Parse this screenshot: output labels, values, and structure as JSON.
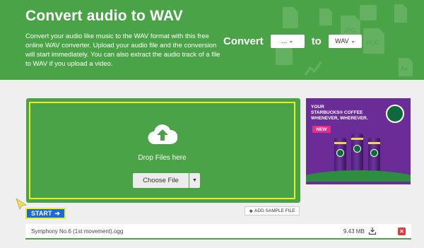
{
  "hero": {
    "title": "Convert audio to WAV",
    "description": "Convert your audio like music to the WAV format with this free online WAV converter. Upload your audio file and the conversion will start immediately. You can also extract the audio track of a file to WAV if you upload a video.",
    "convert_label": "Convert",
    "from_value": "...",
    "to_label": "to",
    "to_value": "WAV",
    "bg_icon_labels": [
      "JPG",
      "PDF",
      "Aa"
    ]
  },
  "upload": {
    "drop_text": "Drop Files here",
    "choose_label": "Choose File",
    "start_label": "START",
    "sample_label": "ADD SAMPLE FILE"
  },
  "files": [
    {
      "name": "Symphony No.6 (1st movement).ogg",
      "size": "9.43 MB"
    }
  ],
  "ad": {
    "headline_lines": [
      "YOUR",
      "STARBUCKS® COFFEE",
      "WHENEVER, WHEREVER."
    ],
    "badge": "NEW"
  },
  "colors": {
    "brand_green": "#4aa447",
    "start_blue": "#1a6bd8",
    "highlight_yellow": "#e1ef2e",
    "delete_red": "#e23a3a",
    "ad_purple": "#6a2c96"
  }
}
